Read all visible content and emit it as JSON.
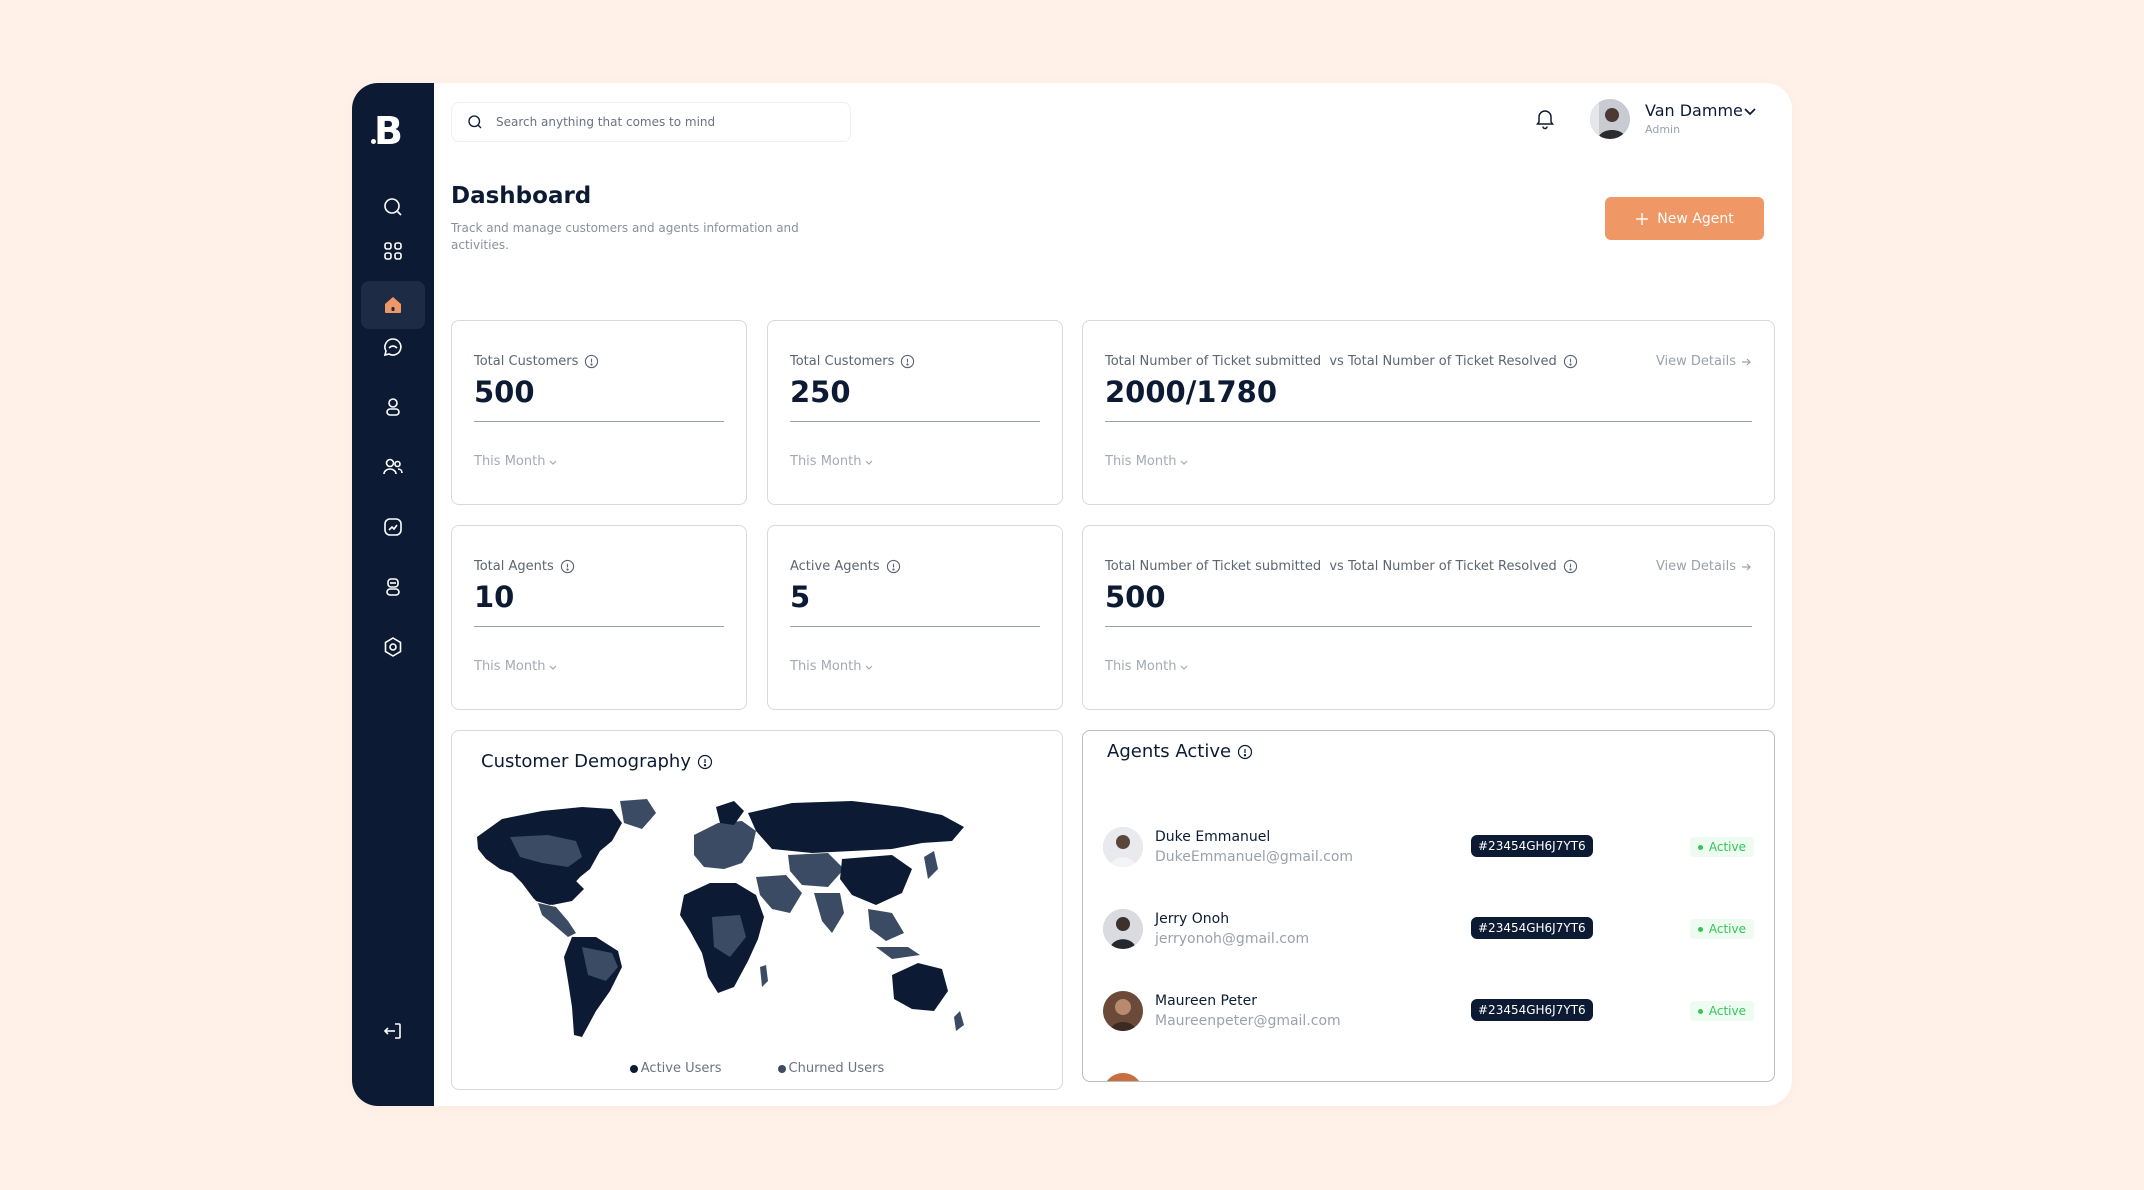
{
  "brand": {
    "logo_letter": "B"
  },
  "search": {
    "placeholder": "Search anything that comes to mind"
  },
  "user": {
    "name": "Van Damme",
    "role": "Admin"
  },
  "header": {
    "title": "Dashboard",
    "subtitle": "Track and manage customers and agents information and activities.",
    "new_agent_label": "New Agent"
  },
  "sidebar": {
    "items": [
      {
        "icon": "search-icon",
        "active": false
      },
      {
        "icon": "grid-icon",
        "active": false
      },
      {
        "icon": "home-icon",
        "active": true
      },
      {
        "icon": "chat-icon",
        "active": false
      },
      {
        "icon": "user-icon",
        "active": false
      },
      {
        "icon": "users-icon",
        "active": false
      },
      {
        "icon": "analytics-icon",
        "active": false
      },
      {
        "icon": "agent-icon",
        "active": false
      },
      {
        "icon": "settings-icon",
        "active": false
      }
    ],
    "logout_icon": "logout-icon"
  },
  "stats": [
    {
      "label": "Total Customers",
      "value": "500",
      "period": "This Month"
    },
    {
      "label": "Total Customers",
      "value": "250",
      "period": "This Month"
    },
    {
      "label": "Total Number of Ticket submitted  vs Total Number of Ticket Resolved",
      "value": "2000/1780",
      "period": "This Month",
      "link": "View Details"
    },
    {
      "label": "Total Agents",
      "value": "10",
      "period": "This Month"
    },
    {
      "label": "Active Agents",
      "value": "5",
      "period": "This Month"
    },
    {
      "label": "Total Number of Ticket submitted  vs Total Number of Ticket Resolved",
      "value": "500",
      "period": "This Month",
      "link": "View Details"
    }
  ],
  "demography": {
    "title": "Customer Demography",
    "legend": [
      {
        "label": "Active Users",
        "color": "#0c1b33"
      },
      {
        "label": "Churned Users",
        "color": "#3b4b64"
      }
    ]
  },
  "agents": {
    "title": "Agents Active",
    "rows": [
      {
        "name": "Duke Emmanuel",
        "email": "DukeEmmanuel@gmail.com",
        "id": "#23454GH6J7YT6",
        "status": "Active"
      },
      {
        "name": "Jerry Onoh",
        "email": "jerryonoh@gmail.com",
        "id": "#23454GH6J7YT6",
        "status": "Active"
      },
      {
        "name": "Maureen Peter",
        "email": "Maureenpeter@gmail.com",
        "id": "#23454GH6J7YT6",
        "status": "Active"
      }
    ]
  },
  "colors": {
    "sidebar_bg": "#0c1b33",
    "accent": "#ef9865",
    "active_status": "#34c45a",
    "page_bg": "#fff1e8"
  }
}
